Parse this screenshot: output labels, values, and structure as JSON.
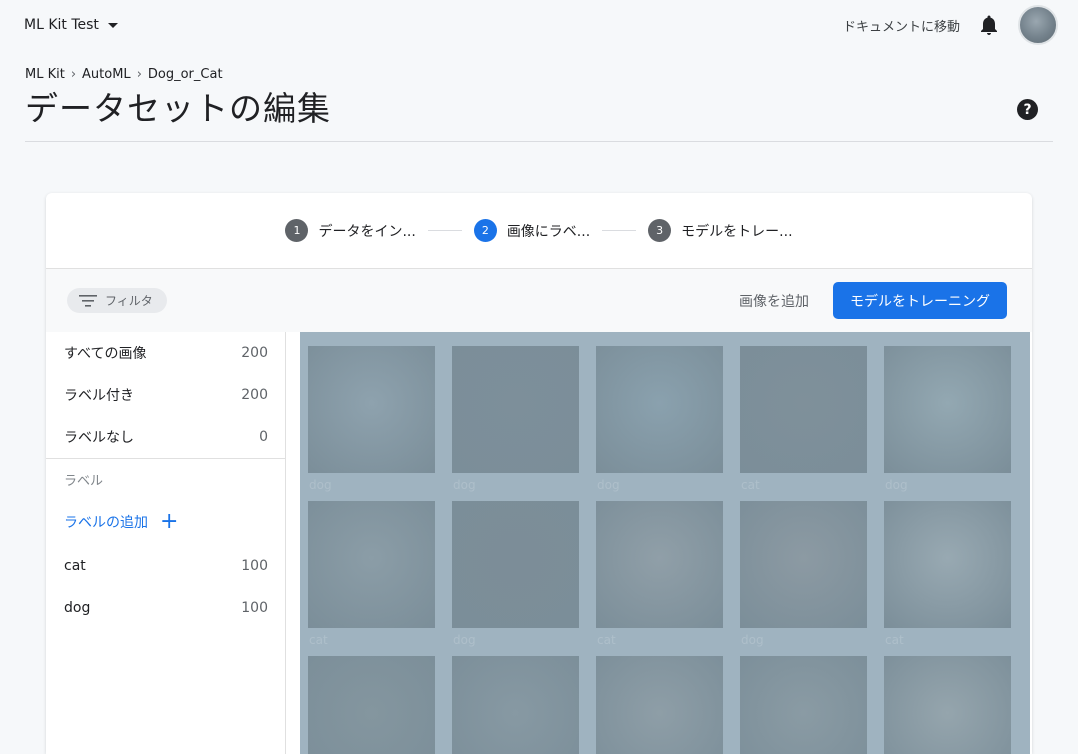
{
  "topbar": {
    "project_name": "ML Kit Test",
    "docs_link": "ドキュメントに移動"
  },
  "breadcrumb": [
    "ML Kit",
    "AutoML",
    "Dog_or_Cat"
  ],
  "page_title": "データセットの編集",
  "help_symbol": "?",
  "stepper": [
    {
      "num": "1",
      "label": "データをイン...",
      "color": "#5f6368"
    },
    {
      "num": "2",
      "label": "画像にラベ...",
      "color": "#1a73e8"
    },
    {
      "num": "3",
      "label": "モデルをトレー...",
      "color": "#5f6368"
    }
  ],
  "toolbar": {
    "filter_label": "フィルタ",
    "add_images_label": "画像を追加",
    "train_button_label": "モデルをトレーニング"
  },
  "sidebar": {
    "summary": [
      {
        "label": "すべての画像",
        "count": "200"
      },
      {
        "label": "ラベル付き",
        "count": "200"
      },
      {
        "label": "ラベルなし",
        "count": "0"
      }
    ],
    "labels_header": "ラベル",
    "add_label_text": "ラベルの追加",
    "labels": [
      {
        "label": "cat",
        "count": "100"
      },
      {
        "label": "dog",
        "count": "100"
      }
    ]
  },
  "images": [
    {
      "label": "dog",
      "color": "#8ea2ae"
    },
    {
      "label": "dog",
      "color": "#7d8f9a"
    },
    {
      "label": "dog",
      "color": "#8aa1ae"
    },
    {
      "label": "cat",
      "color": "#7f909a"
    },
    {
      "label": "dog",
      "color": "#93a8b2"
    },
    {
      "label": "cat",
      "color": "#8b9da7"
    },
    {
      "label": "dog",
      "color": "#7c8d98"
    },
    {
      "label": "cat",
      "color": "#909fa8"
    },
    {
      "label": "dog",
      "color": "#8c9aa3"
    },
    {
      "label": "cat",
      "color": "#98a9b2"
    },
    {
      "label": "",
      "color": "#84969f"
    },
    {
      "label": "",
      "color": "#8799a3"
    },
    {
      "label": "",
      "color": "#8e9ea7"
    },
    {
      "label": "",
      "color": "#8a9ba4"
    },
    {
      "label": "",
      "color": "#95a5ad"
    }
  ],
  "colors": {
    "accent": "#1a73e8",
    "overlay": "#9fb3c0"
  }
}
